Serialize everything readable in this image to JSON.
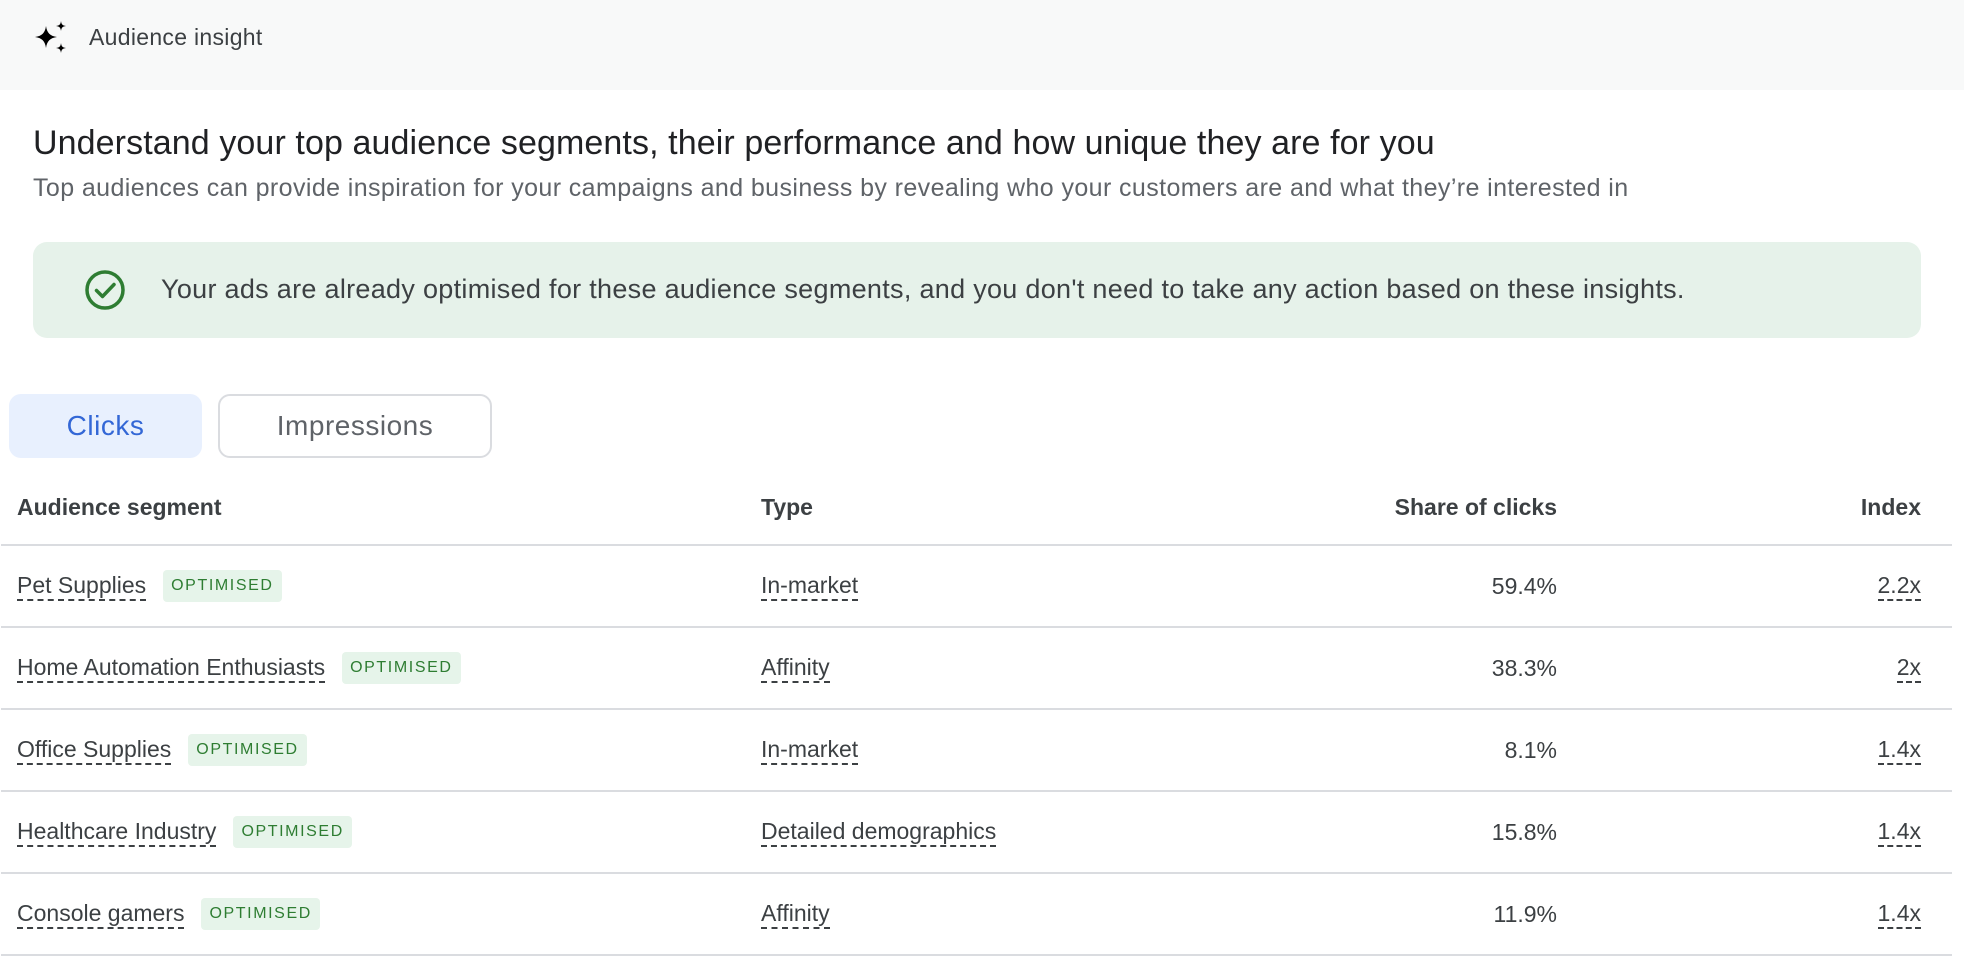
{
  "header": {
    "icon": "sparkle-icon",
    "title": "Audience insight"
  },
  "intro": {
    "headline": "Understand your top audience segments, their performance and how unique they are for you",
    "subhead": "Top audiences can provide inspiration for your campaigns and business by revealing who your customers are and what they’re interested in"
  },
  "banner": {
    "icon": "check-circle-icon",
    "message": "Your ads are already optimised for these audience segments, and you don't need to take any action based on these insights.",
    "color": "#2e7d32",
    "background": "#e6f2ea"
  },
  "tabs": [
    {
      "label": "Clicks",
      "selected": true
    },
    {
      "label": "Impressions",
      "selected": false
    }
  ],
  "table": {
    "columns": [
      "Audience segment",
      "Type",
      "Share of clicks",
      "Index"
    ],
    "rows": [
      {
        "segment": "Pet Supplies",
        "badge": "OPTIMISED",
        "type": "In-market",
        "share": "59.4%",
        "index": "2.2x"
      },
      {
        "segment": "Home Automation Enthusiasts",
        "badge": "OPTIMISED",
        "type": "Affinity",
        "share": "38.3%",
        "index": "2x"
      },
      {
        "segment": "Office Supplies",
        "badge": "OPTIMISED",
        "type": "In-market",
        "share": "8.1%",
        "index": "1.4x"
      },
      {
        "segment": "Healthcare Industry",
        "badge": "OPTIMISED",
        "type": "Detailed demographics",
        "share": "15.8%",
        "index": "1.4x"
      },
      {
        "segment": "Console gamers",
        "badge": "OPTIMISED",
        "type": "Affinity",
        "share": "11.9%",
        "index": "1.4x"
      }
    ]
  }
}
